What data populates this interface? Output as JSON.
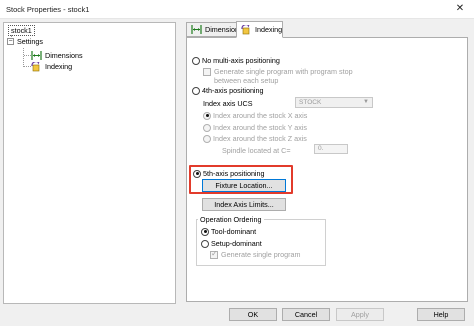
{
  "window": {
    "title": "Stock Properties - stock1",
    "close_glyph": "✕"
  },
  "tree": {
    "root": "stock1",
    "settings": "Settings",
    "items": [
      "Dimensions",
      "Indexing"
    ]
  },
  "tabs": [
    {
      "label": "Dimensions",
      "icon": "dimensions-icon"
    },
    {
      "label": "Indexing",
      "icon": "indexing-icon"
    }
  ],
  "indexing": {
    "no_multi_axis": "No multi-axis positioning",
    "generate_single_program": "Generate single program with program stop between each setup",
    "fourth_axis": "4th-axis positioning",
    "index_axis_ucs_label": "Index axis UCS",
    "index_axis_ucs_value": "STOCK",
    "index_x": "Index around the stock X axis",
    "index_y": "Index around the stock Y axis",
    "index_z": "Index around the stock Z axis",
    "spindle_label": "Spindle located at C=",
    "spindle_value": "0.",
    "fifth_axis": "5th-axis positioning",
    "fixture_location": "Fixture Location...",
    "index_axis_limits": "Index Axis Limits...",
    "operation_ordering": "Operation Ordering",
    "tool_dominant": "Tool-dominant",
    "setup_dominant": "Setup-dominant",
    "generate_single_program_2": "Generate single program"
  },
  "buttons": {
    "ok": "OK",
    "cancel": "Cancel",
    "apply": "Apply",
    "help": "Help"
  },
  "colors": {
    "highlight": "#e23b2b",
    "focus": "#0078d7"
  }
}
